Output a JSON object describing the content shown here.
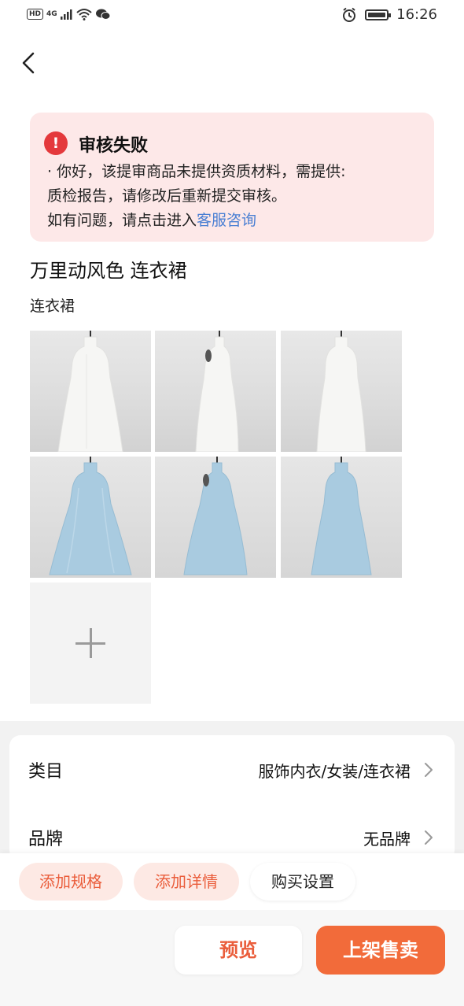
{
  "status_bar": {
    "hd": "HD",
    "network": "4G",
    "time": "16:26"
  },
  "alert": {
    "title": "审核失败",
    "line1": "· 你好，该提审商品未提供资质材料，需提供:",
    "line2": "质检报告，请修改后重新提交审核。",
    "line3_prefix": "如有问题，请点击进入",
    "line3_link": "客服咨询",
    "icon_glyph": "!"
  },
  "product": {
    "title": "万里动风色 连衣裙",
    "subtitle": "连衣裙",
    "images": [
      {
        "color": "white",
        "view": "front"
      },
      {
        "color": "white",
        "view": "side"
      },
      {
        "color": "white",
        "view": "back"
      },
      {
        "color": "blue",
        "view": "front"
      },
      {
        "color": "blue",
        "view": "side"
      },
      {
        "color": "blue",
        "view": "back"
      }
    ]
  },
  "fields": [
    {
      "label": "类目",
      "value": "服饰内衣/女装/连衣裙"
    },
    {
      "label": "品牌",
      "value": "无品牌"
    }
  ],
  "actions": {
    "add_spec": "添加规格",
    "add_detail": "添加详情",
    "purchase_settings": "购买设置"
  },
  "buttons": {
    "preview": "预览",
    "publish": "上架售卖"
  },
  "colors": {
    "accent": "#f26b3a",
    "alert_bg": "#fde8e8",
    "alert_icon": "#e4393c",
    "link": "#4a7fd3"
  }
}
